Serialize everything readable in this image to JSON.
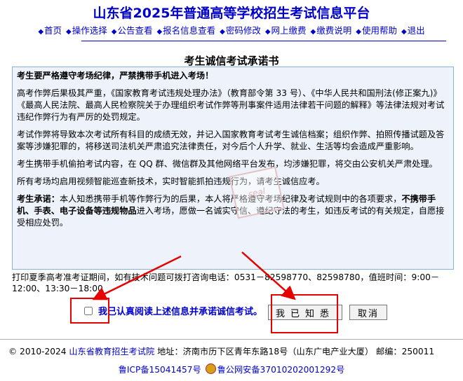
{
  "header": {
    "site_title": "山东省2025年普通高等学校招生考试信息平台",
    "nav": [
      {
        "label": "首页"
      },
      {
        "label": "操作选择"
      },
      {
        "label": "公告查看"
      },
      {
        "label": "报名信息查看"
      },
      {
        "label": "密码修改"
      },
      {
        "label": "网上缴费"
      },
      {
        "label": "缴费说明"
      },
      {
        "label": "使用帮助"
      },
      {
        "label": "退出"
      }
    ]
  },
  "document": {
    "title": "考生诚信考试承诺书",
    "lead": "考生要严格遵守考场纪律，严禁携带手机进入考场！",
    "paragraphs": [
      "高考作弊后果极其严重，《国家教育考试违规处理办法》（教育部令第 33 号）、《中华人民共和国刑法(修正案九)》《最高人民法院、最高人民检察院关于办理组织考试作弊等刑事案件适用法律若干问题的解释》等法律法规对考试违纪作弊行为有严厉的处罚规定。",
      "考试作弊将导致本次考试所有科目的成绩无效，并记入国家教育考试考生诚信档案；组织作弊、拍照传播试题及答案等涉嫌犯罪的，将移送司法机关严肃追究法律责任，对今后个人升学、就业、生活等均会造成严重影响。",
      "考生携带手机偷拍考试内容，在 QQ 群、微信群及其他网络平台发布，均涉嫌犯罪，将交由公安机关严肃处理。",
      "所有考场均启用视频智能巡查新技术，实时智能抓拍违规行为，请考生诚信应考。"
    ],
    "pledge": {
      "label": "考生承诺：",
      "text_1": "本人知悉携带手机等作弊行为的后果，本人将严格遵守考场纪律及考试规则中的各项要求，",
      "emphasis": "不携带手机、手表、电子设备等违规物品",
      "text_2": "进入考场，愿做一名诚实守信、遵纪守法的考生，如违反考试的有关规定，自愿接受相应处罚。"
    }
  },
  "notice": "打印夏季高考准考证期间，如有技术问题可拨打咨询电话：0531－82598770、82598780，值班时间：9:00－12:00、13:30－18:00",
  "consent": {
    "label": "我已认真阅读上述信息并承诺诚信考试。",
    "checked": false
  },
  "buttons": {
    "confirm": "我已知悉",
    "cancel": "取消"
  },
  "footer": {
    "copyright": "© 2010-2024",
    "org": "山东省教育招生考试院",
    "address": "地址：济南市历下区青年东路18号（山东广电产业大厦） 邮编：250011",
    "icp": "鲁ICP备15041457号",
    "police": "鲁公网安备37010202001292号"
  },
  "colors": {
    "link": "#0000cc",
    "highlight": "#e60000",
    "panel_bg": "#eef3fb"
  }
}
